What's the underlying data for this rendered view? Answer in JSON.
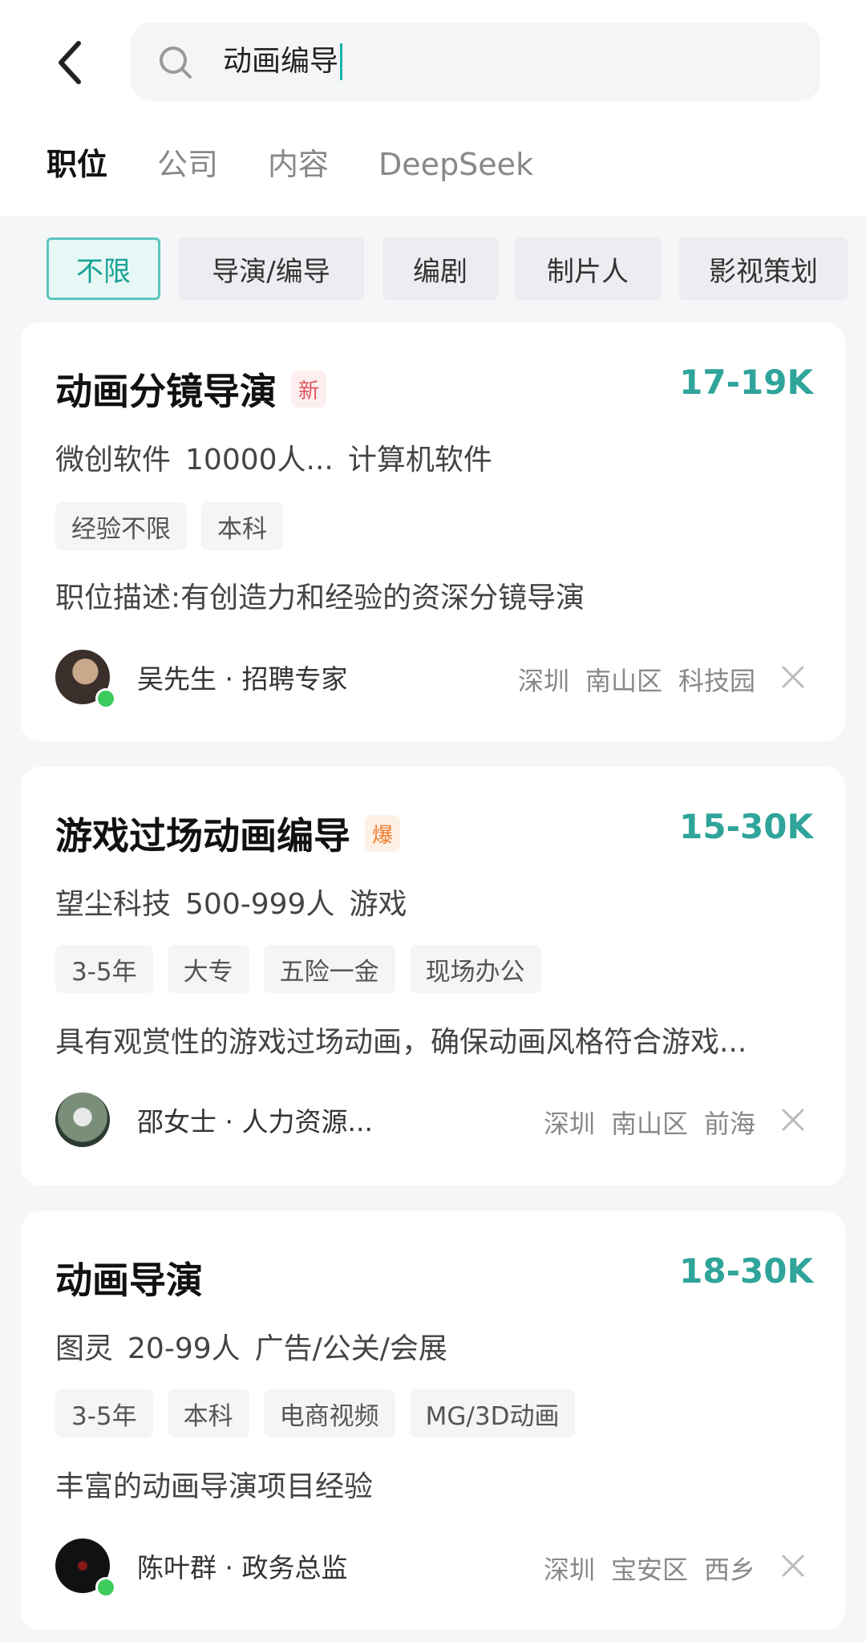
{
  "search": {
    "query": "动画编导"
  },
  "tabs": [
    {
      "label": "职位"
    },
    {
      "label": "公司"
    },
    {
      "label": "内容"
    },
    {
      "label": "DeepSeek"
    }
  ],
  "filters": [
    {
      "label": "不限",
      "active": true
    },
    {
      "label": "导演/编导"
    },
    {
      "label": "编剧"
    },
    {
      "label": "制片人"
    },
    {
      "label": "影视策划"
    }
  ],
  "jobs": [
    {
      "title": "动画分镜导演",
      "badge": "新",
      "salary": "17-19K",
      "company": [
        "微创软件",
        "10000人...",
        "计算机软件"
      ],
      "tags": [
        "经验不限",
        "本科"
      ],
      "description": "职位描述:有创造力和经验的资深分镜导演",
      "recruiter": "吴先生 · 招聘专家",
      "location": [
        "深圳",
        "南山区",
        "科技园"
      ]
    },
    {
      "title": "游戏过场动画编导",
      "badge": "爆",
      "salary": "15-30K",
      "company": [
        "望尘科技",
        "500-999人",
        "游戏"
      ],
      "tags": [
        "3-5年",
        "大专",
        "五险一金",
        "现场办公"
      ],
      "description": "具有观赏性的游戏过场动画，确保动画风格符合游戏...",
      "recruiter": "邵女士 · 人力资源...",
      "location": [
        "深圳",
        "南山区",
        "前海"
      ]
    },
    {
      "title": "动画导演",
      "badge": "",
      "salary": "18-30K",
      "company": [
        "图灵",
        "20-99人",
        "广告/公关/会展"
      ],
      "tags": [
        "3-5年",
        "本科",
        "电商视频",
        "MG/3D动画"
      ],
      "description": "丰富的动画导演项目经验",
      "recruiter": "陈叶群 · 政务总监",
      "location": [
        "深圳",
        "宝安区",
        "西乡"
      ]
    }
  ],
  "colors": {
    "accent": "#2fa49a",
    "online": "#3ccb5c"
  }
}
